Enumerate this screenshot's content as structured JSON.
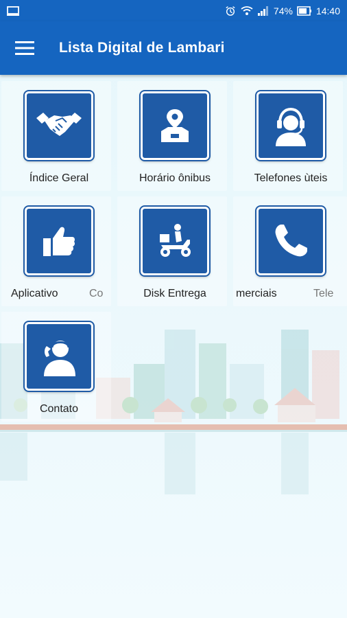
{
  "status_bar": {
    "left_icon": "monitor-icon",
    "battery_percent": "74%",
    "time": "14:40",
    "icons": [
      "alarm-icon",
      "wifi-icon",
      "signal-icon",
      "battery-icon"
    ]
  },
  "app_bar": {
    "title": "Lista Digital de Lambari",
    "menu_icon": "hamburger-menu-icon",
    "background": "#1565c0"
  },
  "tiles": [
    {
      "label": "Índice Geral",
      "icon": "handshake-icon"
    },
    {
      "label": "Horário ônibus",
      "icon": "map-pin-box-icon"
    },
    {
      "label": "Telefones ùteis",
      "icon": "headset-agent-icon"
    },
    {
      "label": "Aplicativo",
      "icon": "thumbs-up-icon"
    },
    {
      "label": "Disk Entrega",
      "icon": "delivery-scooter-icon"
    },
    {
      "label": "Telefones Comerciais",
      "icon": "phone-handset-icon"
    },
    {
      "label": "Contato",
      "icon": "contact-person-icon"
    }
  ],
  "marquee_fragments": {
    "tile4_trailing": "Co",
    "tile6_leading": "merciais",
    "tile6_trailing": "Tele"
  },
  "colors": {
    "primary": "#1565c0",
    "icon_tile": "#1f5ba6"
  }
}
